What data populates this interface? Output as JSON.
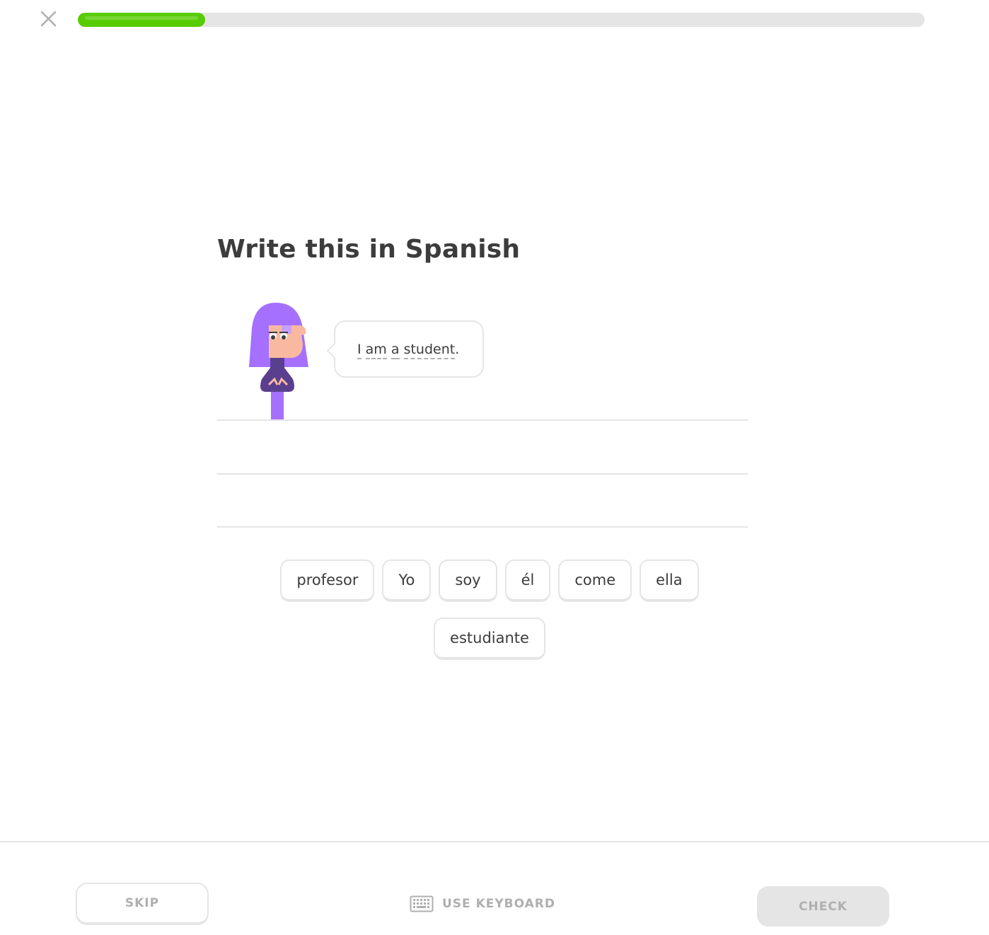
{
  "header": {
    "close_icon": "close-icon",
    "progress_fraction": 0.15
  },
  "challenge": {
    "heading": "Write this in Spanish",
    "prompt_words": [
      "I",
      "am",
      "a",
      "student",
      "."
    ]
  },
  "word_bank": {
    "tiles": [
      "profesor",
      "Yo",
      "soy",
      "él",
      "come",
      "ella",
      "estudiante"
    ]
  },
  "footer": {
    "skip_label": "SKIP",
    "keyboard_label": "USE KEYBOARD",
    "keyboard_icon": "keyboard-icon",
    "check_label": "CHECK"
  },
  "colors": {
    "progress": "#58cc02",
    "character_purple": "#a570ff",
    "disabled": "#afafaf"
  }
}
